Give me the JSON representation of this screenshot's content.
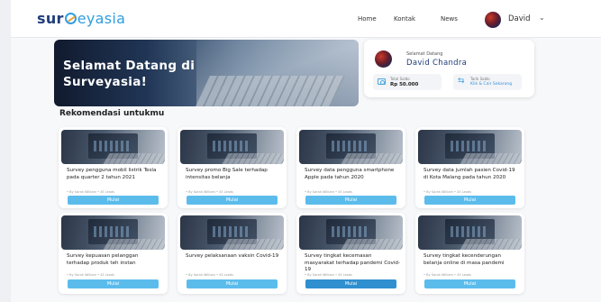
{
  "header": {
    "logo_left": "sur",
    "logo_right": "eyasia",
    "nav": [
      "Home",
      "Kontak",
      "News"
    ],
    "user_name": "David",
    "caret": "⌄"
  },
  "hero": {
    "title": "Selamat Datang di Surveyasia!"
  },
  "welcome": {
    "greeting": "Selamat Datang",
    "name": "David Chandra",
    "balance_label": "Total Saldo",
    "balance_value": "Rp 50.000",
    "withdraw_label": "Tarik Saldo",
    "withdraw_link": "Klik & Cair Sekarang"
  },
  "section": {
    "title": "Rekomendasi untukmu"
  },
  "cards": [
    {
      "title": "Survey pengguna mobil listrik Tesla pada quarter 2 tahun 2021",
      "meta": "• By Sarah William • 45 Leads",
      "button": "Mulai",
      "active": false
    },
    {
      "title": "Survey promo Big Sale terhadap intensitas belanja",
      "meta": "• By Sarah William • 45 Leads",
      "button": "Mulai",
      "active": false
    },
    {
      "title": "Survey data pengguna smartphone Apple pada tahun 2020",
      "meta": "• By Sarah William • 45 Leads",
      "button": "Mulai",
      "active": false
    },
    {
      "title": "Survey data jumlah pasien Covid-19 di Kota Malang pada tahun 2020",
      "meta": "• By Sarah William • 45 Leads",
      "button": "Mulai",
      "active": false
    },
    {
      "title": "Survey kepuasan pelanggan terhadap produk teh instan",
      "meta": "• By Sarah William • 45 Leads",
      "button": "Mulai",
      "active": false
    },
    {
      "title": "Survey pelaksanaan vaksin Covid-19",
      "meta": "• By Sarah William • 45 Leads",
      "button": "Mulai",
      "active": false
    },
    {
      "title": "Survey tingkat kecemasan masyarakat terhadap pandemi Covid-19",
      "meta": "• By Sarah William • 45 Leads",
      "button": "Mulai",
      "active": true
    },
    {
      "title": "Survey tingkat kecenderungan belanja online di masa pandemi",
      "meta": "• By Sarah William • 45 Leads",
      "button": "Mulai",
      "active": false
    }
  ],
  "colors": {
    "brand_dark": "#1f3d7a",
    "brand_light": "#2e9ee0",
    "button": "#5bbcec",
    "button_active": "#2f8fcf"
  }
}
